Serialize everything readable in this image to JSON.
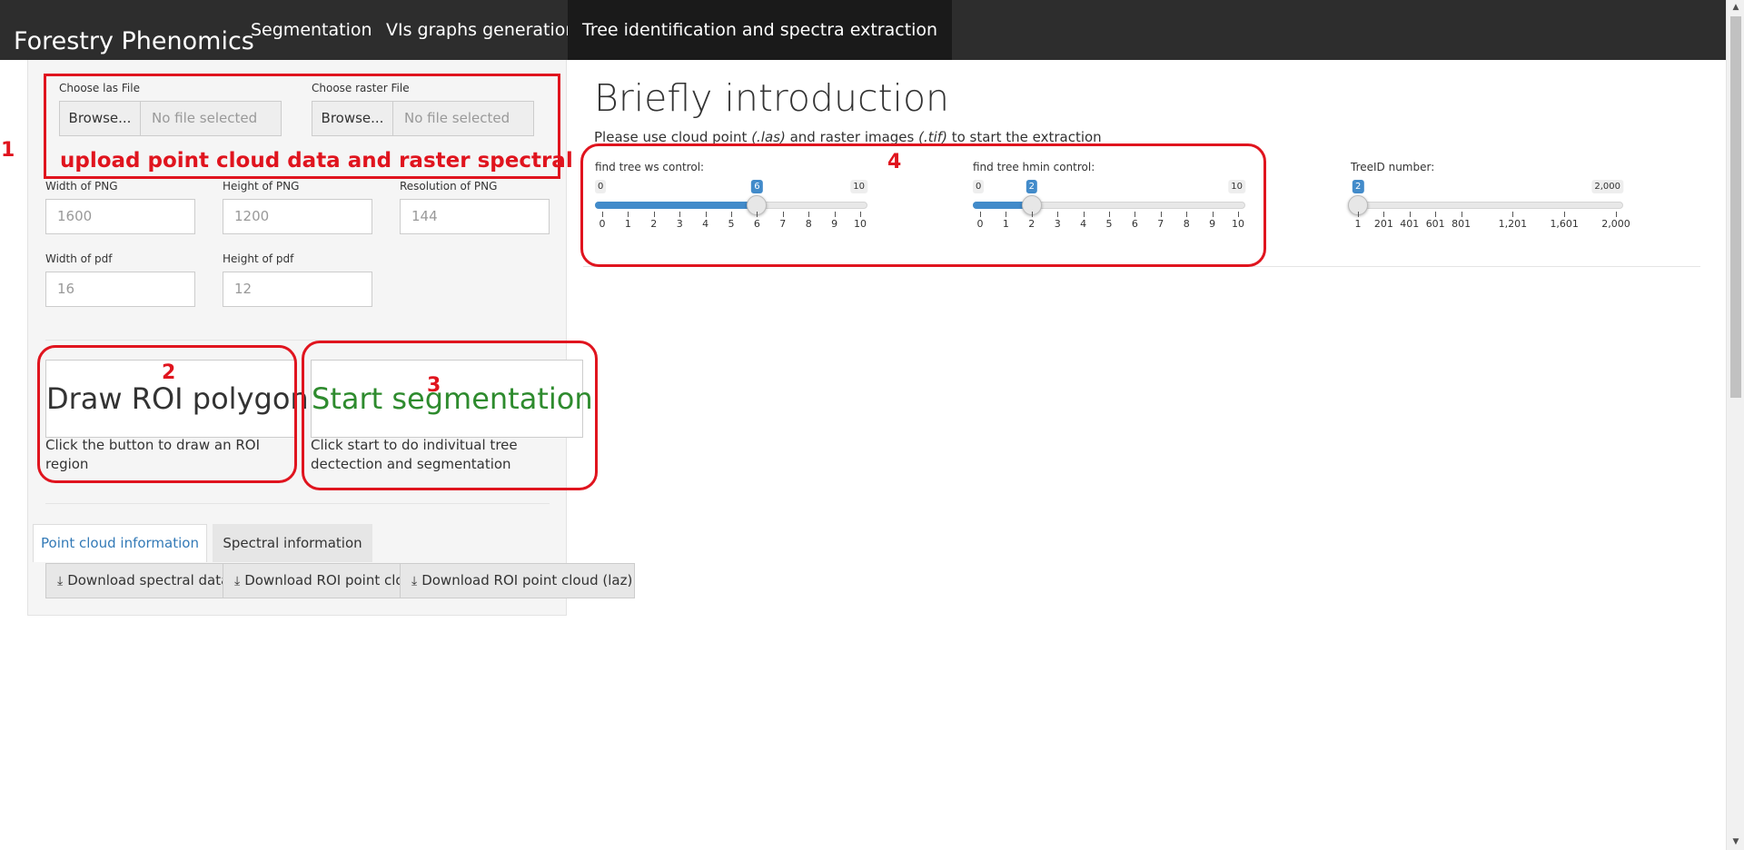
{
  "navbar": {
    "brand": "Forestry Phenomics",
    "tabs": [
      {
        "label": "Segmentation"
      },
      {
        "label": "VIs graphs generation"
      },
      {
        "label": "Tree identification and spectra extraction"
      }
    ]
  },
  "sidebar": {
    "las_file": {
      "label": "Choose las File",
      "button": "Browse...",
      "placeholder": "No file selected"
    },
    "raster_file": {
      "label": "Choose raster File",
      "button": "Browse...",
      "placeholder": "No file selected"
    },
    "png_width": {
      "label": "Width of PNG",
      "value": "1600"
    },
    "png_height": {
      "label": "Height of PNG",
      "value": "1200"
    },
    "png_resolution": {
      "label": "Resolution of PNG",
      "value": "144"
    },
    "pdf_width": {
      "label": "Width of pdf",
      "value": "16"
    },
    "pdf_height": {
      "label": "Height of pdf",
      "value": "12"
    },
    "draw_roi": {
      "label": "Draw ROI polygon",
      "help": "Click the button to draw an ROI region"
    },
    "start_seg": {
      "label": "Start segmentation",
      "help": "Click start to do indivitual tree dectection and segmentation"
    },
    "tabs": [
      {
        "label": "Point cloud information"
      },
      {
        "label": "Spectral information"
      }
    ],
    "downloads": [
      {
        "label": "Download spectral data"
      },
      {
        "label": "Download ROI point cloud (las)"
      },
      {
        "label": "Download ROI point cloud (laz)"
      }
    ]
  },
  "main": {
    "title": "Briefly introduction",
    "intro_before": "Please use cloud point ",
    "intro_las": "(.las)",
    "intro_mid": " and raster images ",
    "intro_tif": "(.tif)",
    "intro_after": " to start the extraction",
    "sliders": [
      {
        "label": "find tree ws control:",
        "min": "0",
        "max": "10",
        "value": "6",
        "fraction": 0.6,
        "ticks": [
          "0",
          "1",
          "2",
          "3",
          "4",
          "5",
          "6",
          "7",
          "8",
          "9",
          "10"
        ]
      },
      {
        "label": "find tree hmin control:",
        "min": "0",
        "max": "10",
        "value": "2",
        "fraction": 0.2,
        "ticks": [
          "0",
          "1",
          "2",
          "3",
          "4",
          "5",
          "6",
          "7",
          "8",
          "9",
          "10"
        ]
      },
      {
        "label": "TreeID number:",
        "min": "",
        "max": "2,000",
        "value": "2",
        "fraction": 0.0005,
        "ticks": [
          "1",
          "201",
          "401",
          "601",
          "801",
          "1,201",
          "1,601",
          "2,000"
        ]
      }
    ]
  },
  "annotations": {
    "n1": "1",
    "n2": "2",
    "n3": "3",
    "n4": "4",
    "upload_note": "upload point cloud data and raster spectral"
  },
  "colors": {
    "annotation_red": "#e0141e",
    "slider_blue": "#428bca",
    "start_green": "#2e8b2e",
    "navbar_bg": "#2d2d2d"
  }
}
